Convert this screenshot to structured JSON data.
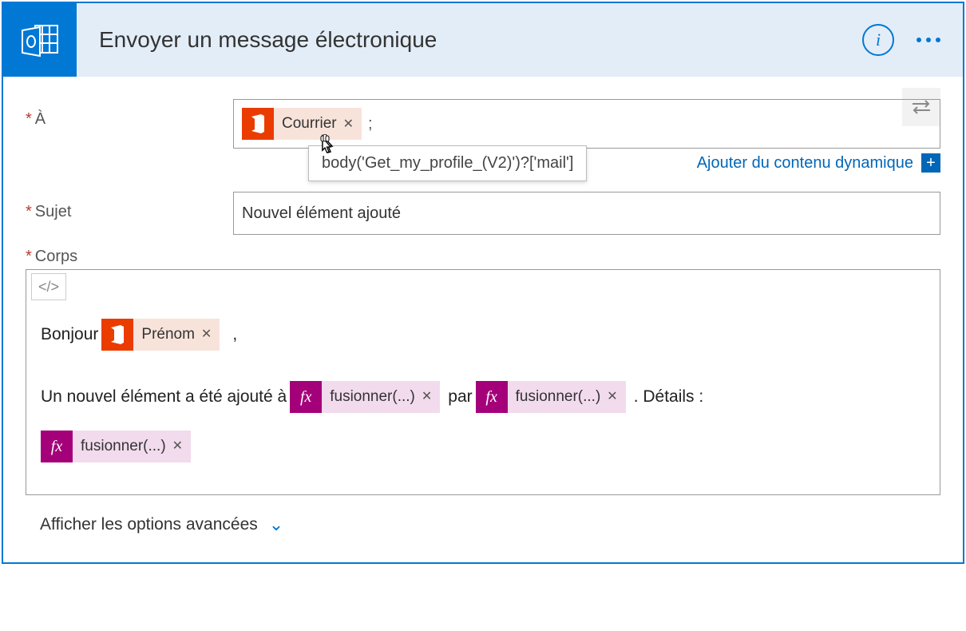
{
  "header": {
    "title": "Envoyer un message électronique",
    "info_label": "i"
  },
  "fields": {
    "to": {
      "label": "À",
      "token": {
        "type": "office",
        "text": "Courrier"
      },
      "separator": ";",
      "tooltip": "body('Get_my_profile_(V2)')?['mail']"
    },
    "dynamic": {
      "link": "Ajouter du contenu dynamique",
      "plus": "+"
    },
    "subject": {
      "label": "Sujet",
      "value": "Nouvel élément ajouté"
    },
    "body": {
      "label": "Corps",
      "code_button": "</>",
      "line1_prefix": "Bonjour",
      "line1_token": {
        "type": "office",
        "text": "Prénom"
      },
      "line1_suffix": ",",
      "line2_prefix": "Un nouvel élément a été ajouté à",
      "line2_token1": {
        "type": "fx",
        "text": "fusionner(...)"
      },
      "line2_mid": "par",
      "line2_token2": {
        "type": "fx",
        "text": "fusionner(...)"
      },
      "line2_suffix": ". Détails :",
      "line3_token": {
        "type": "fx",
        "text": "fusionner(...)"
      }
    },
    "advanced": "Afficher les options avancées"
  },
  "icons": {
    "fx": "fx",
    "close": "✕",
    "chevron": "⌄"
  }
}
